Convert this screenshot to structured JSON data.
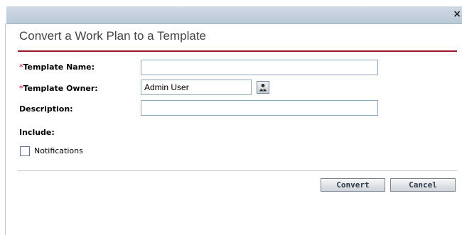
{
  "window": {
    "close_glyph": "×",
    "close_icon": "close-icon"
  },
  "dialog": {
    "title": "Convert a Work Plan to a Template"
  },
  "form": {
    "template_name": {
      "label": "Template Name:",
      "required": true,
      "value": ""
    },
    "template_owner": {
      "label": "Template Owner:",
      "required": true,
      "value": "Admin User",
      "lookup_icon": "user-lookup-icon"
    },
    "description": {
      "label": "Description:",
      "value": ""
    },
    "required_marker": "*",
    "include": {
      "label": "Include:",
      "notifications": {
        "label": "Notifications",
        "checked": false
      }
    }
  },
  "buttons": {
    "convert": "Convert",
    "cancel": "Cancel"
  },
  "colors": {
    "accent_rule": "#9c1b2b",
    "required_marker": "#c4001e",
    "titlebar": "#c3d1dd"
  }
}
